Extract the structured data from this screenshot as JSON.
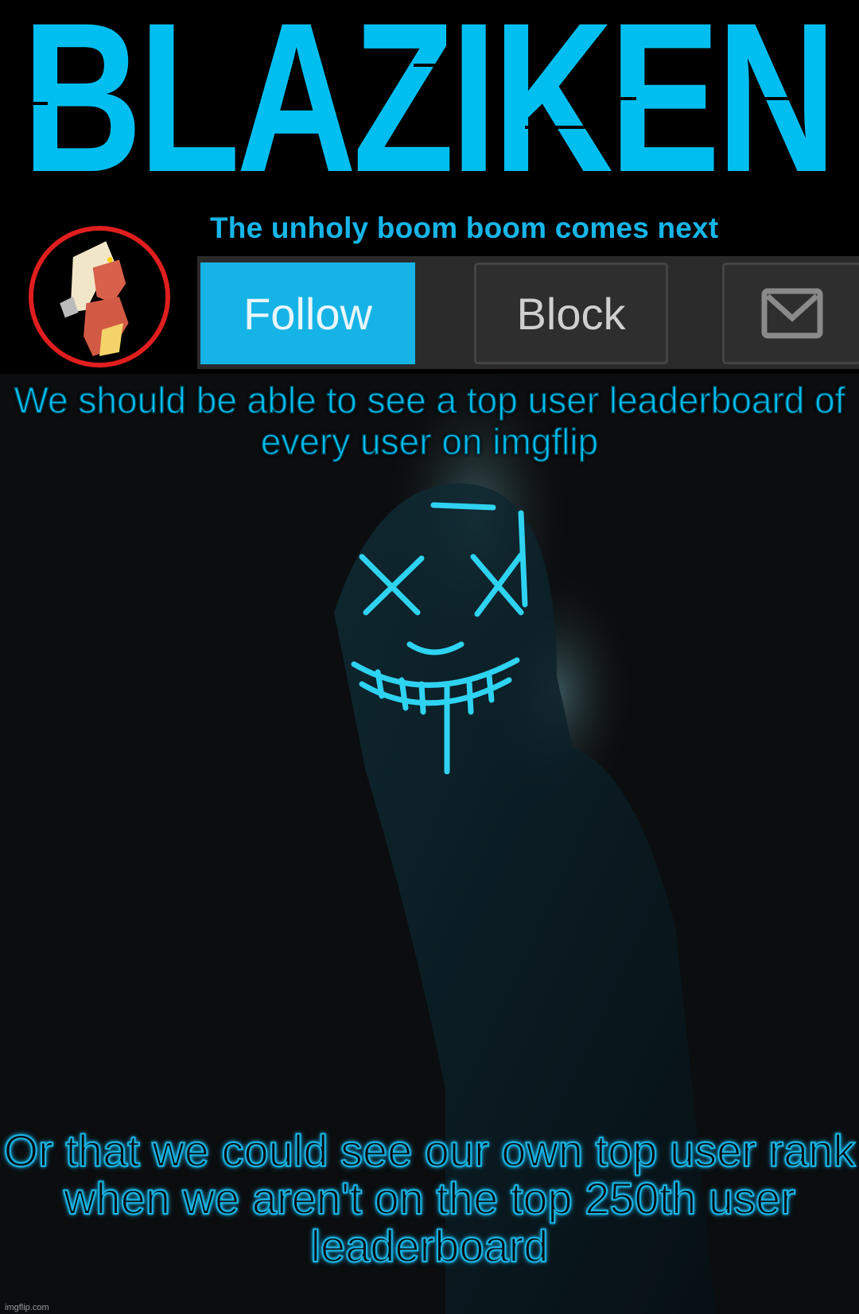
{
  "header": {
    "logo_text": "BLAZIKEN",
    "tagline": "The unholy boom boom comes next",
    "avatar_alt": "Blaziken avatar",
    "buttons": {
      "follow": "Follow",
      "block": "Block",
      "mail_icon": "envelope-icon"
    }
  },
  "captions": {
    "top": "We should be able to see a top user leaderboard of every user on imgflip",
    "bottom": "Or that we could see our own top user rank when we aren't on the top 250th user leaderboard"
  },
  "watermark": "imgflip.com",
  "colors": {
    "accent": "#00bff0",
    "follow_bg": "#16b4e6",
    "avatar_ring": "#e01e1e",
    "button_bar": "#2a2a2a"
  }
}
